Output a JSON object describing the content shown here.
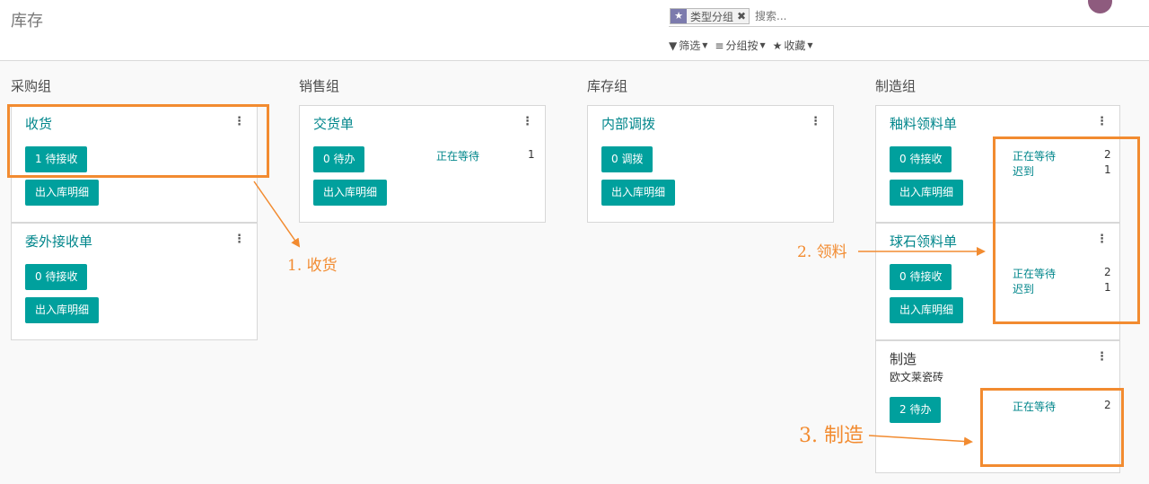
{
  "header": {
    "title": "库存",
    "search": {
      "facet_label": "类型分组",
      "placeholder": "搜索..."
    },
    "filters": [
      "筛选",
      "分组按",
      "收藏"
    ]
  },
  "columns": [
    {
      "title": "采购组"
    },
    {
      "title": "销售组"
    },
    {
      "title": "库存组"
    },
    {
      "title": "制造组"
    }
  ],
  "cards": {
    "receipt": {
      "name": "收货",
      "primary": "1 待接收",
      "secondary": "出入库明细"
    },
    "outsource": {
      "name": "委外接收单",
      "primary": "0 待接收",
      "secondary": "出入库明细"
    },
    "delivery": {
      "name": "交货单",
      "primary": "0 待办",
      "secondary": "出入库明细",
      "stats": [
        {
          "label": "正在等待",
          "value": "1"
        }
      ]
    },
    "internal": {
      "name": "内部调拨",
      "primary": "0 调拨",
      "secondary": "出入库明细"
    },
    "glaze": {
      "name": "釉料领料单",
      "primary": "0 待接收",
      "secondary": "出入库明细",
      "stats": [
        {
          "label": "正在等待",
          "value": "2"
        },
        {
          "label": "迟到",
          "value": "1"
        }
      ]
    },
    "ball": {
      "name": "球石领料单",
      "primary": "0 待接收",
      "secondary": "出入库明细",
      "stats": [
        {
          "label": "正在等待",
          "value": "2"
        },
        {
          "label": "迟到",
          "value": "1"
        }
      ]
    },
    "manufacture": {
      "name": "制造",
      "subtitle": "欧文莱瓷砖",
      "primary": "2 待办",
      "stats": [
        {
          "label": "正在等待",
          "value": "2"
        }
      ]
    }
  },
  "annotations": [
    "1. 收货",
    "2. 领料",
    "3. 制造"
  ],
  "colors": {
    "accent": "#00a09d",
    "annotation": "#f28b30",
    "link": "#00868b"
  }
}
